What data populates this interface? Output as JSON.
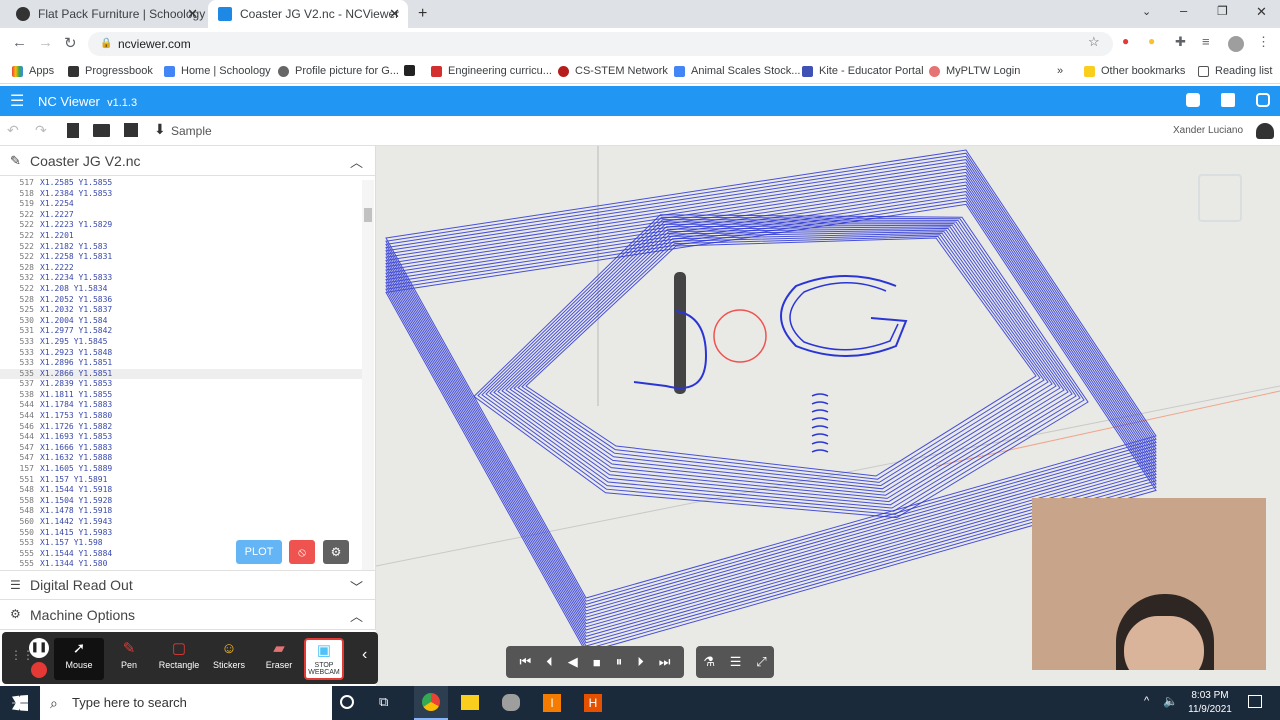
{
  "browser": {
    "tabs": [
      {
        "title": "Flat Pack Furniture | Schoology",
        "active": false
      },
      {
        "title": "Coaster JG V2.nc - NCViewer",
        "active": true
      }
    ],
    "url": "ncviewer.com",
    "bookmarks": [
      "Apps",
      "Progressbook",
      "Home | Schoology",
      "Profile picture for G...",
      "Engineering curricu...",
      "CS-STEM Network",
      "Animal Scales Stock...",
      "Kite - Educator Portal",
      "MyPLTW Login",
      "Other bookmarks",
      "Reading list"
    ]
  },
  "app": {
    "name": "NC Viewer",
    "version": "v1.1.3",
    "sample_label": "Sample",
    "user": "Xander Luciano",
    "accent": "#2196f3"
  },
  "file_panel": {
    "title": "Coaster JG V2.nc",
    "lines": [
      {
        "n": "517",
        "code": "X1.2585 Y1.5855"
      },
      {
        "n": "518",
        "code": "X1.2384 Y1.5853"
      },
      {
        "n": "519",
        "code": "X1.2254"
      },
      {
        "n": "522",
        "code": "X1.2227"
      },
      {
        "n": "522",
        "code": "X1.2223 Y1.5829"
      },
      {
        "n": "522",
        "code": "X1.2201"
      },
      {
        "n": "522",
        "code": "X1.2182 Y1.583"
      },
      {
        "n": "522",
        "code": "X1.2258 Y1.5831"
      },
      {
        "n": "528",
        "code": "X1.2222"
      },
      {
        "n": "532",
        "code": "X1.2234 Y1.5833"
      },
      {
        "n": "522",
        "code": "X1.208 Y1.5834"
      },
      {
        "n": "528",
        "code": "X1.2052 Y1.5836"
      },
      {
        "n": "525",
        "code": "X1.2032 Y1.5837"
      },
      {
        "n": "530",
        "code": "X1.2004 Y1.584"
      },
      {
        "n": "531",
        "code": "X1.2977 Y1.5842"
      },
      {
        "n": "533",
        "code": "X1.295 Y1.5845"
      },
      {
        "n": "533",
        "code": "X1.2923 Y1.5848"
      },
      {
        "n": "533",
        "code": "X1.2896 Y1.5851"
      },
      {
        "n": "535",
        "code": "X1.2866 Y1.5851"
      },
      {
        "n": "537",
        "code": "X1.2839 Y1.5853"
      },
      {
        "n": "538",
        "code": "X1.1811 Y1.5855"
      },
      {
        "n": "544",
        "code": "X1.1784 Y1.5883"
      },
      {
        "n": "544",
        "code": "X1.1753 Y1.5880"
      },
      {
        "n": "546",
        "code": "X1.1726 Y1.5882"
      },
      {
        "n": "544",
        "code": "X1.1693 Y1.5853"
      },
      {
        "n": "547",
        "code": "X1.1666 Y1.5883"
      },
      {
        "n": "547",
        "code": "X1.1632 Y1.5888"
      },
      {
        "n": "157",
        "code": "X1.1605 Y1.5889"
      },
      {
        "n": "551",
        "code": "X1.157 Y1.5891"
      },
      {
        "n": "548",
        "code": "X1.1544 Y1.5918"
      },
      {
        "n": "558",
        "code": "X1.1504 Y1.5928"
      },
      {
        "n": "548",
        "code": "X1.1478 Y1.5918"
      },
      {
        "n": "560",
        "code": "X1.1442 Y1.5943"
      },
      {
        "n": "550",
        "code": "X1.1415 Y1.5983"
      },
      {
        "n": "553",
        "code": "X1.157 Y1.598"
      },
      {
        "n": "555",
        "code": "X1.1544 Y1.5884"
      },
      {
        "n": "555",
        "code": "X1.1344 Y1.580"
      }
    ],
    "highlight_index": 18,
    "plot_label": "PLOT"
  },
  "sections": {
    "dro": "Digital Read Out",
    "machine": "Machine Options"
  },
  "annotation_tools": [
    {
      "label": "Mouse",
      "icon": "cursor-icon"
    },
    {
      "label": "Pen",
      "icon": "pen-icon"
    },
    {
      "label": "Rectangle",
      "icon": "rectangle-icon"
    },
    {
      "label": "Stickers",
      "icon": "sticker-icon"
    },
    {
      "label": "Eraser",
      "icon": "eraser-icon"
    },
    {
      "label": "STOP WEBCAM",
      "icon": "webcam-icon"
    }
  ],
  "taskbar": {
    "search_placeholder": "Type here to search",
    "time": "8:03 PM",
    "date": "11/9/2021"
  }
}
